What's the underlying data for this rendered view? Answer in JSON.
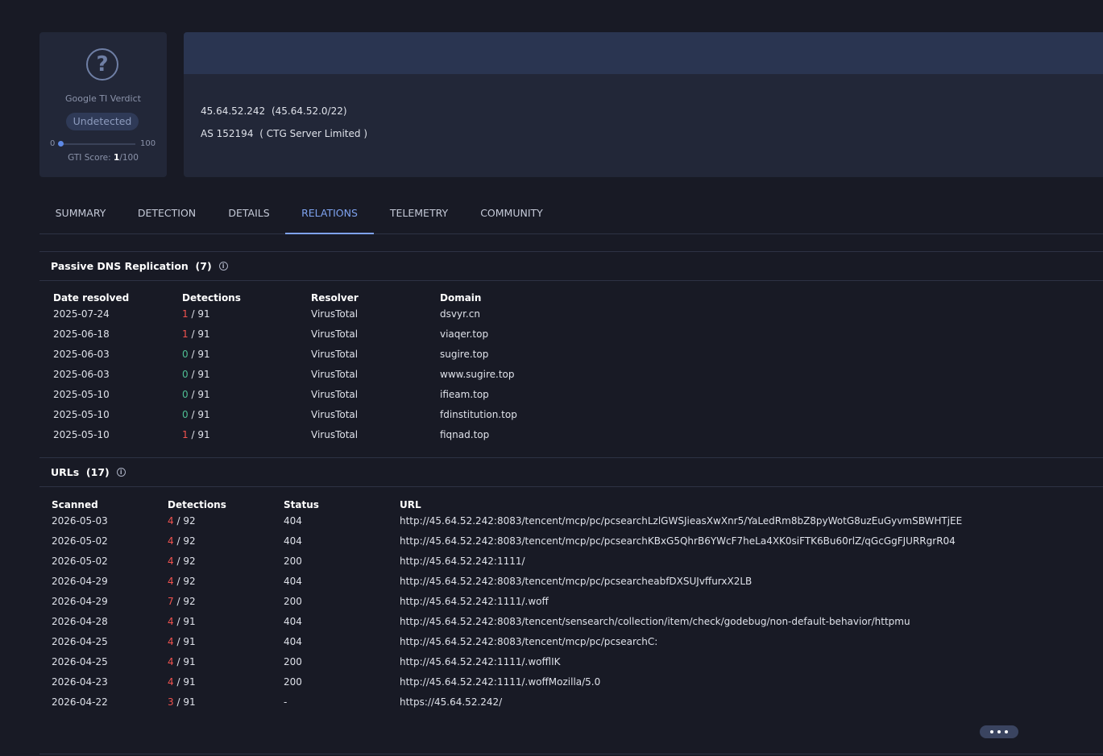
{
  "verdict": {
    "icon": "question-circle-icon",
    "label": "Google TI Verdict",
    "badge": "Undetected",
    "score_min": "0",
    "score_max": "100",
    "score_prefix": "GTI Score: ",
    "score_value": "1",
    "score_suffix": "/100",
    "score_fraction": 0.01
  },
  "ip": {
    "address": "45.64.52.242",
    "network": "(45.64.52.0/22)",
    "asn": "AS 152194",
    "owner": "( CTG Server Limited )"
  },
  "tabs": [
    "SUMMARY",
    "DETECTION",
    "DETAILS",
    "RELATIONS",
    "TELEMETRY",
    "COMMUNITY"
  ],
  "active_tab": "RELATIONS",
  "passive_dns": {
    "title": "Passive DNS Replication",
    "count": "(7)",
    "headers": [
      "Date resolved",
      "Detections",
      "Resolver",
      "Domain"
    ],
    "rows": [
      {
        "date": "2025-07-24",
        "det": "1",
        "total": " / 91",
        "resolver": "VirusTotal",
        "domain": "dsvyr.cn"
      },
      {
        "date": "2025-06-18",
        "det": "1",
        "total": " / 91",
        "resolver": "VirusTotal",
        "domain": "viaqer.top"
      },
      {
        "date": "2025-06-03",
        "det": "0",
        "total": " / 91",
        "resolver": "VirusTotal",
        "domain": "sugire.top"
      },
      {
        "date": "2025-06-03",
        "det": "0",
        "total": " / 91",
        "resolver": "VirusTotal",
        "domain": "www.sugire.top"
      },
      {
        "date": "2025-05-10",
        "det": "0",
        "total": " / 91",
        "resolver": "VirusTotal",
        "domain": "ifieam.top"
      },
      {
        "date": "2025-05-10",
        "det": "0",
        "total": " / 91",
        "resolver": "VirusTotal",
        "domain": "fdinstitution.top"
      },
      {
        "date": "2025-05-10",
        "det": "1",
        "total": " / 91",
        "resolver": "VirusTotal",
        "domain": "fiqnad.top"
      }
    ]
  },
  "urls": {
    "title": "URLs",
    "count": "(17)",
    "headers": [
      "Scanned",
      "Detections",
      "Status",
      "URL"
    ],
    "rows": [
      {
        "scanned": "2026-05-03",
        "det": "4",
        "total": " / 92",
        "status": "404",
        "url": "http://45.64.52.242:8083/tencent/mcp/pc/pcsearchLzlGWSJieasXwXnr5/YaLedRm8bZ8pyWotG8uzEuGyvmSBWHTjEE"
      },
      {
        "scanned": "2026-05-02",
        "det": "4",
        "total": " / 92",
        "status": "404",
        "url": "http://45.64.52.242:8083/tencent/mcp/pc/pcsearchKBxG5QhrB6YWcF7heLa4XK0siFTK6Bu60rlZ/qGcGgFJURRgrR04"
      },
      {
        "scanned": "2026-05-02",
        "det": "4",
        "total": " / 92",
        "status": "200",
        "url": "http://45.64.52.242:1111/"
      },
      {
        "scanned": "2026-04-29",
        "det": "4",
        "total": " / 92",
        "status": "404",
        "url": "http://45.64.52.242:8083/tencent/mcp/pc/pcsearcheabfDXSUJvffurxX2LB"
      },
      {
        "scanned": "2026-04-29",
        "det": "7",
        "total": " / 92",
        "status": "200",
        "url": "http://45.64.52.242:1111/.woff"
      },
      {
        "scanned": "2026-04-28",
        "det": "4",
        "total": " / 91",
        "status": "404",
        "url": "http://45.64.52.242:8083/tencent/sensearch/collection/item/check/godebug/non-default-behavior/httpmu"
      },
      {
        "scanned": "2026-04-25",
        "det": "4",
        "total": " / 91",
        "status": "404",
        "url": "http://45.64.52.242:8083/tencent/mcp/pc/pcsearchC:"
      },
      {
        "scanned": "2026-04-25",
        "det": "4",
        "total": " / 91",
        "status": "200",
        "url": "http://45.64.52.242:1111/.wofflIK"
      },
      {
        "scanned": "2026-04-23",
        "det": "4",
        "total": " / 91",
        "status": "200",
        "url": "http://45.64.52.242:1111/.woffMozilla/5.0"
      },
      {
        "scanned": "2026-04-22",
        "det": "3",
        "total": " / 91",
        "status": "-",
        "url": "https://45.64.52.242/"
      }
    ],
    "more_icon": "more-dots-icon"
  }
}
